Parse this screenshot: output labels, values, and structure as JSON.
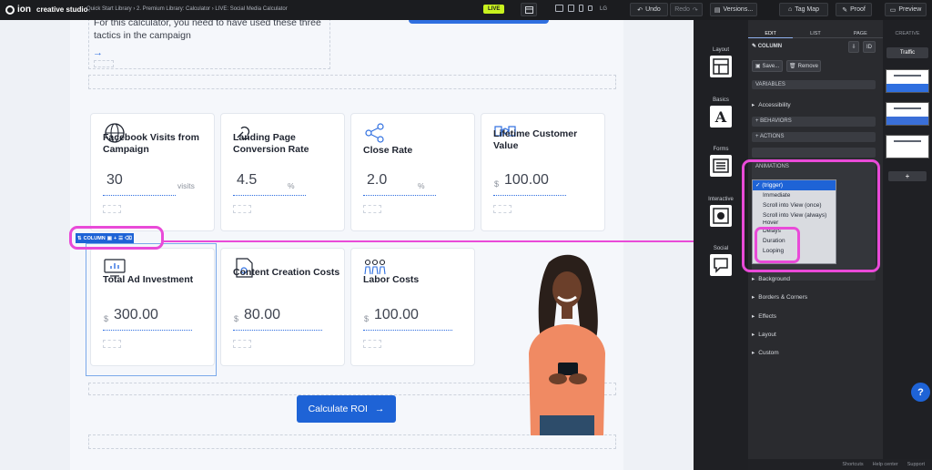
{
  "topbar": {
    "brand": "ion",
    "brand_sub": "creative studio",
    "breadcrumb": "Quick Start Library  ›  2. Premium Library: Calculator  ›  LIVE: Social Media Calculator",
    "live_badge": "LIVE",
    "device_label": "LG",
    "undo": "Undo",
    "redo": "Redo",
    "versions": "Versions...",
    "tag_map": "Tag Map",
    "proof": "Proof",
    "preview": "Preview"
  },
  "page": {
    "intro_text": "For this calculator, you need to have used these three tactics in the campaign",
    "arrow": "→",
    "cards_row1": [
      {
        "title": "Facebook Visits from Campaign",
        "currency": "",
        "value": "30",
        "unit": "visits",
        "icon": "globe-icon"
      },
      {
        "title": "Landing Page Conversion Rate",
        "currency": "",
        "value": "4.5",
        "unit": "%",
        "icon": "link-icon"
      },
      {
        "title": "Close Rate",
        "currency": "",
        "value": "2.0",
        "unit": "%",
        "icon": "share-icon"
      },
      {
        "title": "Lifetime Customer Value",
        "currency": "$",
        "value": "100.00",
        "unit": "",
        "icon": "handshake-icon"
      }
    ],
    "cards_row2": [
      {
        "title": "Total Ad Investment",
        "currency": "$",
        "value": "300.00",
        "unit": "",
        "icon": "monitor-chart-icon"
      },
      {
        "title": "Content Creation Costs",
        "currency": "$",
        "value": "80.00",
        "unit": "",
        "icon": "document-icon"
      },
      {
        "title": "Labor Costs",
        "currency": "$",
        "value": "100.00",
        "unit": "",
        "icon": "people-icon"
      }
    ],
    "calculate_button": "Calculate ROI",
    "calculate_arrow": "→"
  },
  "column_toolbar": {
    "label": "COLUMN"
  },
  "rail": {
    "items": [
      {
        "label": "Layout",
        "icon": "layout-icon"
      },
      {
        "label": "Basics",
        "icon": "text-icon",
        "glyph": "A"
      },
      {
        "label": "Forms",
        "icon": "form-icon"
      },
      {
        "label": "Interactive",
        "icon": "play-icon"
      },
      {
        "label": "Social",
        "icon": "chat-icon"
      }
    ]
  },
  "props": {
    "tabs": [
      "EDIT",
      "LIST",
      "PAGE"
    ],
    "element_title": "COLUMN",
    "id_label": "ID",
    "save": "Save...",
    "remove": "Remove",
    "variables": "VARIABLES",
    "accessibility": "Accessibility",
    "behaviors": "+ BEHAVIORS",
    "actions": "+ ACTIONS",
    "animations": "ANIMATIONS",
    "sections": [
      "Background",
      "Borders & Corners",
      "Effects",
      "Layout",
      "Custom"
    ]
  },
  "dropdown": {
    "options": [
      "(trigger)",
      "Immediate",
      "Scroll into View (once)",
      "Scroll into View (always)",
      "Hover",
      "Delays",
      "Duration",
      "Looping"
    ],
    "selected": "(trigger)"
  },
  "pages_panel": {
    "title": "CREATIVE",
    "tab": "Traffic",
    "add": "+"
  },
  "statusbar": {
    "shortcuts": "Shortcuts",
    "help_center": "Help center",
    "support": "Support"
  },
  "help_button": "?"
}
